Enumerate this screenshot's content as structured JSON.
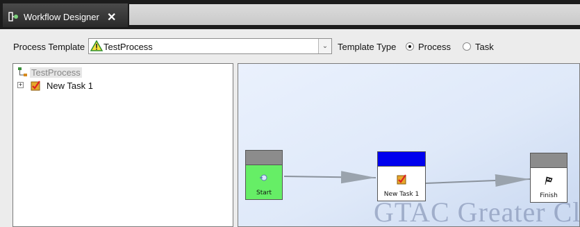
{
  "tab": {
    "title": "Workflow Designer",
    "close_glyph": "✕",
    "icon": "workflow-icon"
  },
  "toolbar": {
    "process_template_label": "Process Template",
    "process_template_value": "TestProcess",
    "template_type_label": "Template Type",
    "options": [
      {
        "label": "Process",
        "selected": true
      },
      {
        "label": "Task",
        "selected": false
      }
    ]
  },
  "tree": {
    "root": {
      "label": "TestProcess",
      "icon": "process-tree-icon"
    },
    "children": [
      {
        "label": "New Task 1",
        "icon": "task-icon",
        "expander": "+"
      }
    ]
  },
  "canvas": {
    "nodes": [
      {
        "label": "Start",
        "icon": "start-icon",
        "header_color": "#8c8c8c",
        "body_color": "#66ee66"
      },
      {
        "label": "New Task 1",
        "icon": "task-icon",
        "header_color": "#0000ee",
        "body_color": "#ffffff"
      },
      {
        "label": "Finish",
        "icon": "finish-flag-icon",
        "header_color": "#8c8c8c",
        "body_color": "#ffffff"
      }
    ],
    "watermark": "GTAC Greater Cl"
  }
}
